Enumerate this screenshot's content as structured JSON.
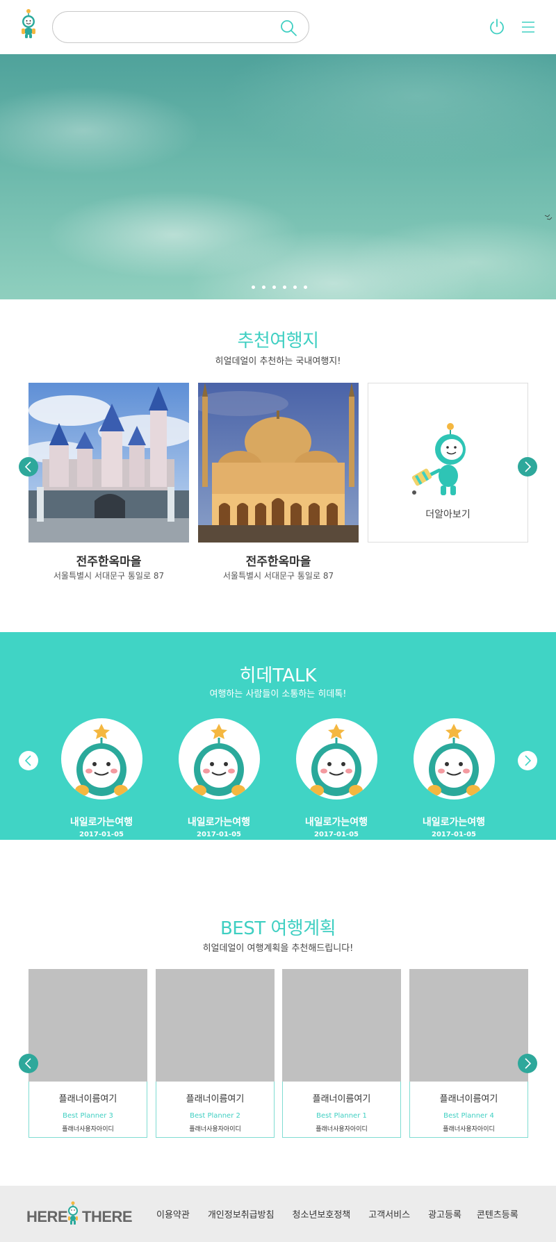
{
  "header": {
    "search_placeholder": "",
    "icons": [
      "logo-mascot",
      "search-icon",
      "power-icon",
      "menu-icon"
    ]
  },
  "hero": {
    "slide_count": 6,
    "active_slide": 1
  },
  "recommend": {
    "title": "추천여행지",
    "subtitle": "히얼데얼이 추천하는 국내여행지!",
    "places": [
      {
        "name": "전주한옥마을",
        "address": "서울특별시 서대문구 통일로 87"
      },
      {
        "name": "전주한옥마을",
        "address": "서울특별시 서대문구 통일로 87"
      }
    ],
    "more_label": "더알아보기"
  },
  "talk": {
    "title": "히데TALK",
    "subtitle": "여행하는 사람들이 소통하는 히데톡!",
    "posts": [
      {
        "title": "내일로가는여행",
        "date": "2017-01-05"
      },
      {
        "title": "내일로가는여행",
        "date": "2017-01-05"
      },
      {
        "title": "내일로가는여행",
        "date": "2017-01-05"
      },
      {
        "title": "내일로가는여행",
        "date": "2017-01-05"
      }
    ]
  },
  "best": {
    "title": "BEST 여행계획",
    "subtitle": "히얼데얼이 여행계획을 추천해드립니다!",
    "plans": [
      {
        "title": "플래너이름여기",
        "rank": "Best Planner 3",
        "user": "플래너사용자아이디"
      },
      {
        "title": "플래너이름여기",
        "rank": "Best Planner 2",
        "user": "플래너사용자아이디"
      },
      {
        "title": "플래너이름여기",
        "rank": "Best Planner 1",
        "user": "플래너사용자아이디"
      },
      {
        "title": "플래너이름여기",
        "rank": "Best Planner 4",
        "user": "플래너사용자아이디"
      }
    ]
  },
  "footer": {
    "logo_word1": "HERE",
    "logo_word2": "THERE",
    "links": [
      "이용약관",
      "개인정보취급방침",
      "청소년보호정책",
      "고객서비스",
      "광고등록",
      "콘텐츠등록"
    ]
  },
  "colors": {
    "accent": "#3fcfc2",
    "teal_band": "#40d4c5",
    "arrow": "#2ea89b",
    "placeholder_gray": "#c0c0c0",
    "footer_bg": "#ececec"
  }
}
